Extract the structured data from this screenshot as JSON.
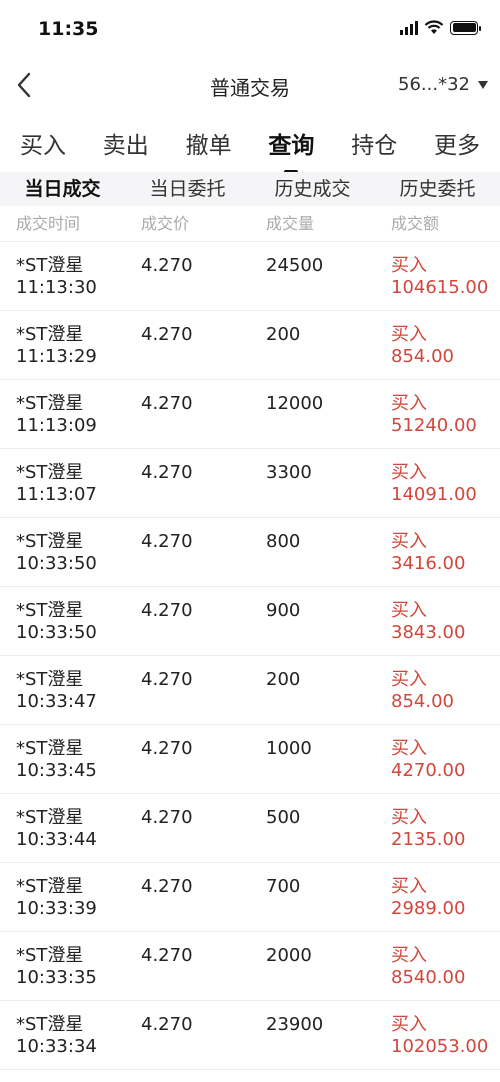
{
  "status": {
    "time": "11:35"
  },
  "nav": {
    "title": "普通交易",
    "account": "56...*32"
  },
  "main_tabs": [
    "买入",
    "卖出",
    "撤单",
    "查询",
    "持仓",
    "更多"
  ],
  "sub_tabs": [
    "当日成交",
    "当日委托",
    "历史成交",
    "历史委托"
  ],
  "columns": [
    "成交时间",
    "成交价",
    "成交量",
    "成交额"
  ],
  "rows": [
    {
      "name": "*ST澄星",
      "time": "11:13:30",
      "price": "4.270",
      "volume": "24500",
      "side": "买入",
      "amount": "104615.00"
    },
    {
      "name": "*ST澄星",
      "time": "11:13:29",
      "price": "4.270",
      "volume": "200",
      "side": "买入",
      "amount": "854.00"
    },
    {
      "name": "*ST澄星",
      "time": "11:13:09",
      "price": "4.270",
      "volume": "12000",
      "side": "买入",
      "amount": "51240.00"
    },
    {
      "name": "*ST澄星",
      "time": "11:13:07",
      "price": "4.270",
      "volume": "3300",
      "side": "买入",
      "amount": "14091.00"
    },
    {
      "name": "*ST澄星",
      "time": "10:33:50",
      "price": "4.270",
      "volume": "800",
      "side": "买入",
      "amount": "3416.00"
    },
    {
      "name": "*ST澄星",
      "time": "10:33:50",
      "price": "4.270",
      "volume": "900",
      "side": "买入",
      "amount": "3843.00"
    },
    {
      "name": "*ST澄星",
      "time": "10:33:47",
      "price": "4.270",
      "volume": "200",
      "side": "买入",
      "amount": "854.00"
    },
    {
      "name": "*ST澄星",
      "time": "10:33:45",
      "price": "4.270",
      "volume": "1000",
      "side": "买入",
      "amount": "4270.00"
    },
    {
      "name": "*ST澄星",
      "time": "10:33:44",
      "price": "4.270",
      "volume": "500",
      "side": "买入",
      "amount": "2135.00"
    },
    {
      "name": "*ST澄星",
      "time": "10:33:39",
      "price": "4.270",
      "volume": "700",
      "side": "买入",
      "amount": "2989.00"
    },
    {
      "name": "*ST澄星",
      "time": "10:33:35",
      "price": "4.270",
      "volume": "2000",
      "side": "买入",
      "amount": "8540.00"
    },
    {
      "name": "*ST澄星",
      "time": "10:33:34",
      "price": "4.270",
      "volume": "23900",
      "side": "买入",
      "amount": "102053.00"
    }
  ],
  "colors": {
    "buy": "#d0473b",
    "header_text": "#aaaaaa",
    "subtab_bg": "#f5f5f7"
  }
}
